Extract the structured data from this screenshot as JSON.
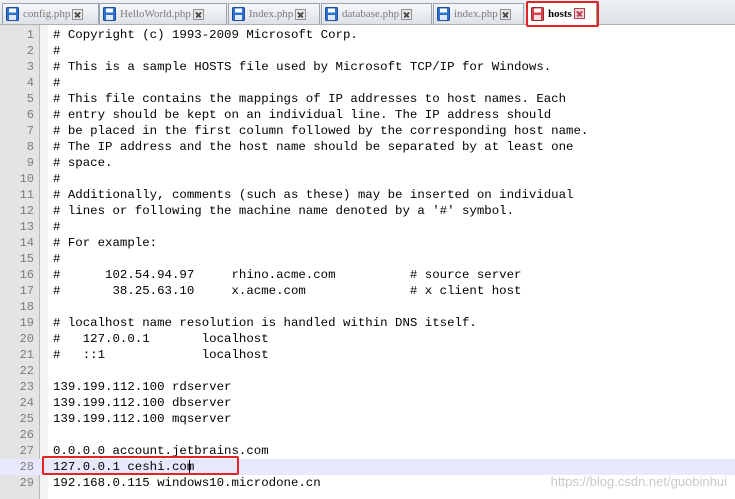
{
  "tabs": [
    {
      "label": "config.php",
      "active": false
    },
    {
      "label": "HelloWorld.php",
      "active": false
    },
    {
      "label": "Index.php",
      "active": false
    },
    {
      "label": "database.php",
      "active": false
    },
    {
      "label": "index.php",
      "active": false
    },
    {
      "label": "hosts",
      "active": true
    }
  ],
  "editor": {
    "current_line": 28,
    "lines": [
      {
        "num": "1",
        "text": "# Copyright (c) 1993-2009 Microsoft Corp."
      },
      {
        "num": "2",
        "text": "#"
      },
      {
        "num": "3",
        "text": "# This is a sample HOSTS file used by Microsoft TCP/IP for Windows."
      },
      {
        "num": "4",
        "text": "#"
      },
      {
        "num": "5",
        "text": "# This file contains the mappings of IP addresses to host names. Each"
      },
      {
        "num": "6",
        "text": "# entry should be kept on an individual line. The IP address should"
      },
      {
        "num": "7",
        "text": "# be placed in the first column followed by the corresponding host name."
      },
      {
        "num": "8",
        "text": "# The IP address and the host name should be separated by at least one"
      },
      {
        "num": "9",
        "text": "# space."
      },
      {
        "num": "10",
        "text": "#"
      },
      {
        "num": "11",
        "text": "# Additionally, comments (such as these) may be inserted on individual"
      },
      {
        "num": "12",
        "text": "# lines or following the machine name denoted by a '#' symbol."
      },
      {
        "num": "13",
        "text": "#"
      },
      {
        "num": "14",
        "text": "# For example:"
      },
      {
        "num": "15",
        "text": "#"
      },
      {
        "num": "16",
        "text": "#      102.54.94.97     rhino.acme.com          # source server"
      },
      {
        "num": "17",
        "text": "#       38.25.63.10     x.acme.com              # x client host"
      },
      {
        "num": "18",
        "text": ""
      },
      {
        "num": "19",
        "text": "# localhost name resolution is handled within DNS itself."
      },
      {
        "num": "20",
        "text": "#   127.0.0.1       localhost"
      },
      {
        "num": "21",
        "text": "#   ::1             localhost"
      },
      {
        "num": "22",
        "text": ""
      },
      {
        "num": "23",
        "text": "139.199.112.100 rdserver"
      },
      {
        "num": "24",
        "text": "139.199.112.100 dbserver"
      },
      {
        "num": "25",
        "text": "139.199.112.100 mqserver"
      },
      {
        "num": "26",
        "text": ""
      },
      {
        "num": "27",
        "text": "0.0.0.0 account.jetbrains.com"
      },
      {
        "num": "28",
        "text": "127.0.0.1 ceshi.com"
      },
      {
        "num": "29",
        "text": "192.168.0.115 windows10.microdone.cn"
      }
    ]
  },
  "watermark": "https://blog.csdn.net/guobinhui",
  "colors": {
    "highlight_box": "#e32424",
    "current_line_bg": "#e8e8ff",
    "gutter_bg": "#e4e4e4",
    "file_icon_blue": "#2f6fd0",
    "file_icon_red": "#d9414b"
  },
  "icons": {
    "tab_file": "floppy-disk-icon",
    "tab_close": "close-icon"
  }
}
